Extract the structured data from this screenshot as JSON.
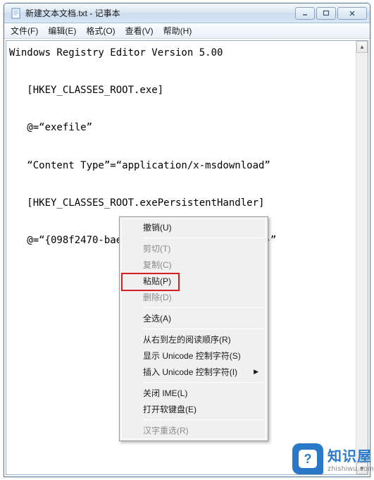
{
  "window": {
    "title": "新建文本文档.txt - 记事本"
  },
  "menubar": {
    "file": "文件(F)",
    "edit": "编辑(E)",
    "format": "格式(O)",
    "view": "查看(V)",
    "help": "帮助(H)"
  },
  "editor": {
    "content": "Windows Registry Editor Version 5.00\n\n   [HKEY_CLASSES_ROOT.exe]\n\n   @=“exefile”\n\n   “Content Type”=“application/x-msdownload”\n\n   [HKEY_CLASSES_ROOT.exePersistentHandler]\n\n   @=“{098f2470-bae0-11cd-b579-08002b30bfeb}”"
  },
  "context_menu": {
    "undo": "撤销(U)",
    "cut": "剪切(T)",
    "copy": "复制(C)",
    "paste": "粘贴(P)",
    "delete": "删除(D)",
    "select_all": "全选(A)",
    "rtl": "从右到左的阅读顺序(R)",
    "show_unicode": "显示 Unicode 控制字符(S)",
    "insert_unicode": "插入 Unicode 控制字符(I)",
    "close_ime": "关闭 IME(L)",
    "soft_keyboard": "打开软键盘(E)",
    "reconvert": "汉字重选(R)"
  },
  "watermark": {
    "title": "知识屋",
    "sub": "zhishiwu.com"
  }
}
